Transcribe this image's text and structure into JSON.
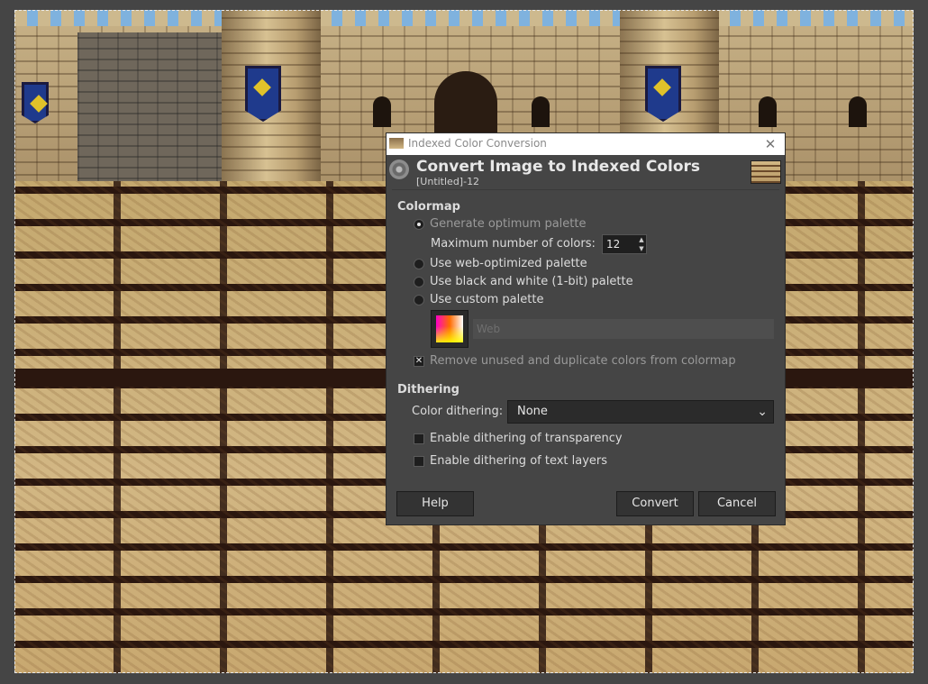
{
  "dialog": {
    "window_title": "Indexed Color Conversion",
    "close_symbol": "✕",
    "header_title": "Convert Image to Indexed Colors",
    "header_subtitle": "[Untitled]-12",
    "colormap": {
      "section_title": "Colormap",
      "generate_optimum": "Generate optimum palette",
      "max_colors_label": "Maximum number of colors:",
      "max_colors_value": "12",
      "web_optimized": "Use web-optimized palette",
      "black_white": "Use black and white (1-bit) palette",
      "custom_palette": "Use custom palette",
      "custom_palette_name": "Web",
      "remove_unused": "Remove unused and duplicate colors from colormap",
      "remove_unused_checked": true,
      "selected_option": "generate_optimum"
    },
    "dithering": {
      "section_title": "Dithering",
      "color_dithering_label": "Color dithering:",
      "color_dithering_value": "None",
      "transparency_label": "Enable dithering of transparency",
      "transparency_checked": false,
      "text_layers_label": "Enable dithering of text layers",
      "text_layers_checked": false
    },
    "buttons": {
      "help": "Help",
      "convert": "Convert",
      "cancel": "Cancel"
    }
  },
  "icons": {
    "header": "gimp-wilber-icon",
    "thumbnail": "image-thumbnail-icon",
    "close": "close-icon",
    "dropdown": "chevron-down-icon",
    "palette": "palette-icon"
  }
}
